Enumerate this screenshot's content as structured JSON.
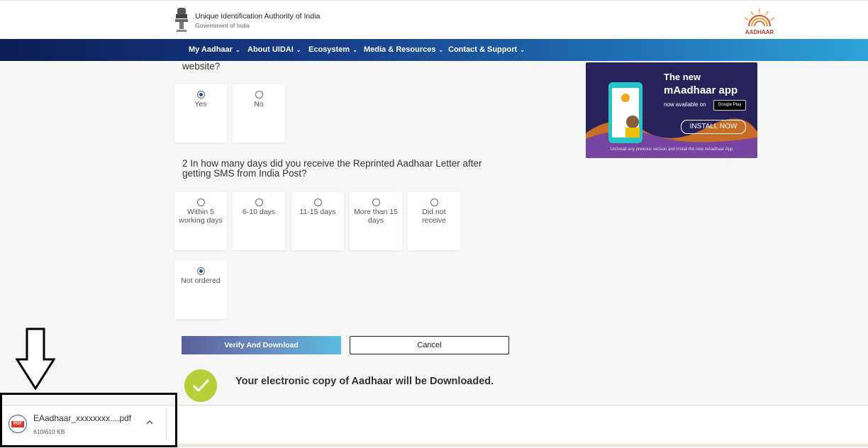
{
  "header": {
    "org_title": "Unique Identification Authority of India",
    "org_subtitle": "Government of India",
    "logo_text": "AADHAAR"
  },
  "nav": {
    "items": [
      {
        "label": "My Aadhaar"
      },
      {
        "label": "About UIDAI"
      },
      {
        "label": "Ecosystem"
      },
      {
        "label": "Media & Resources"
      },
      {
        "label": "Contact & Support"
      }
    ]
  },
  "question1": {
    "text_tail": "website?",
    "options": [
      {
        "label": "Yes",
        "selected": true
      },
      {
        "label": "No",
        "selected": false
      }
    ]
  },
  "question2": {
    "text": "2 In how many days did you receive the Reprinted Aadhaar Letter after getting SMS from India Post?",
    "options": [
      {
        "label": "Within 5 working days",
        "selected": false
      },
      {
        "label": "6-10 days",
        "selected": false
      },
      {
        "label": "11-15 days",
        "selected": false
      },
      {
        "label": "More than 15 days",
        "selected": false
      },
      {
        "label": "Did not receive",
        "selected": false
      },
      {
        "label": "Not ordered",
        "selected": true
      }
    ]
  },
  "actions": {
    "verify_label": "Verify And Download",
    "cancel_label": "Cancel"
  },
  "status": {
    "message": "Your electronic copy of Aadhaar will be Downloaded."
  },
  "ad": {
    "line1": "The new",
    "line2": "mAadhaar app",
    "line3": "now available on",
    "store_badge": "Google Play",
    "install_label": "INSTALL NOW",
    "footer": "Uninstall any previous version and Install the new mAadhaar App"
  },
  "download": {
    "filename": "EAadhaar_xxxxxxxx....pdf",
    "size": "610/610 KB",
    "icon_label": "PDF"
  },
  "colors": {
    "nav_start": "#0b1d55",
    "nav_end": "#2ea3d8",
    "radio_selected": "#1f4fa0",
    "success": "#b9cf3a"
  }
}
